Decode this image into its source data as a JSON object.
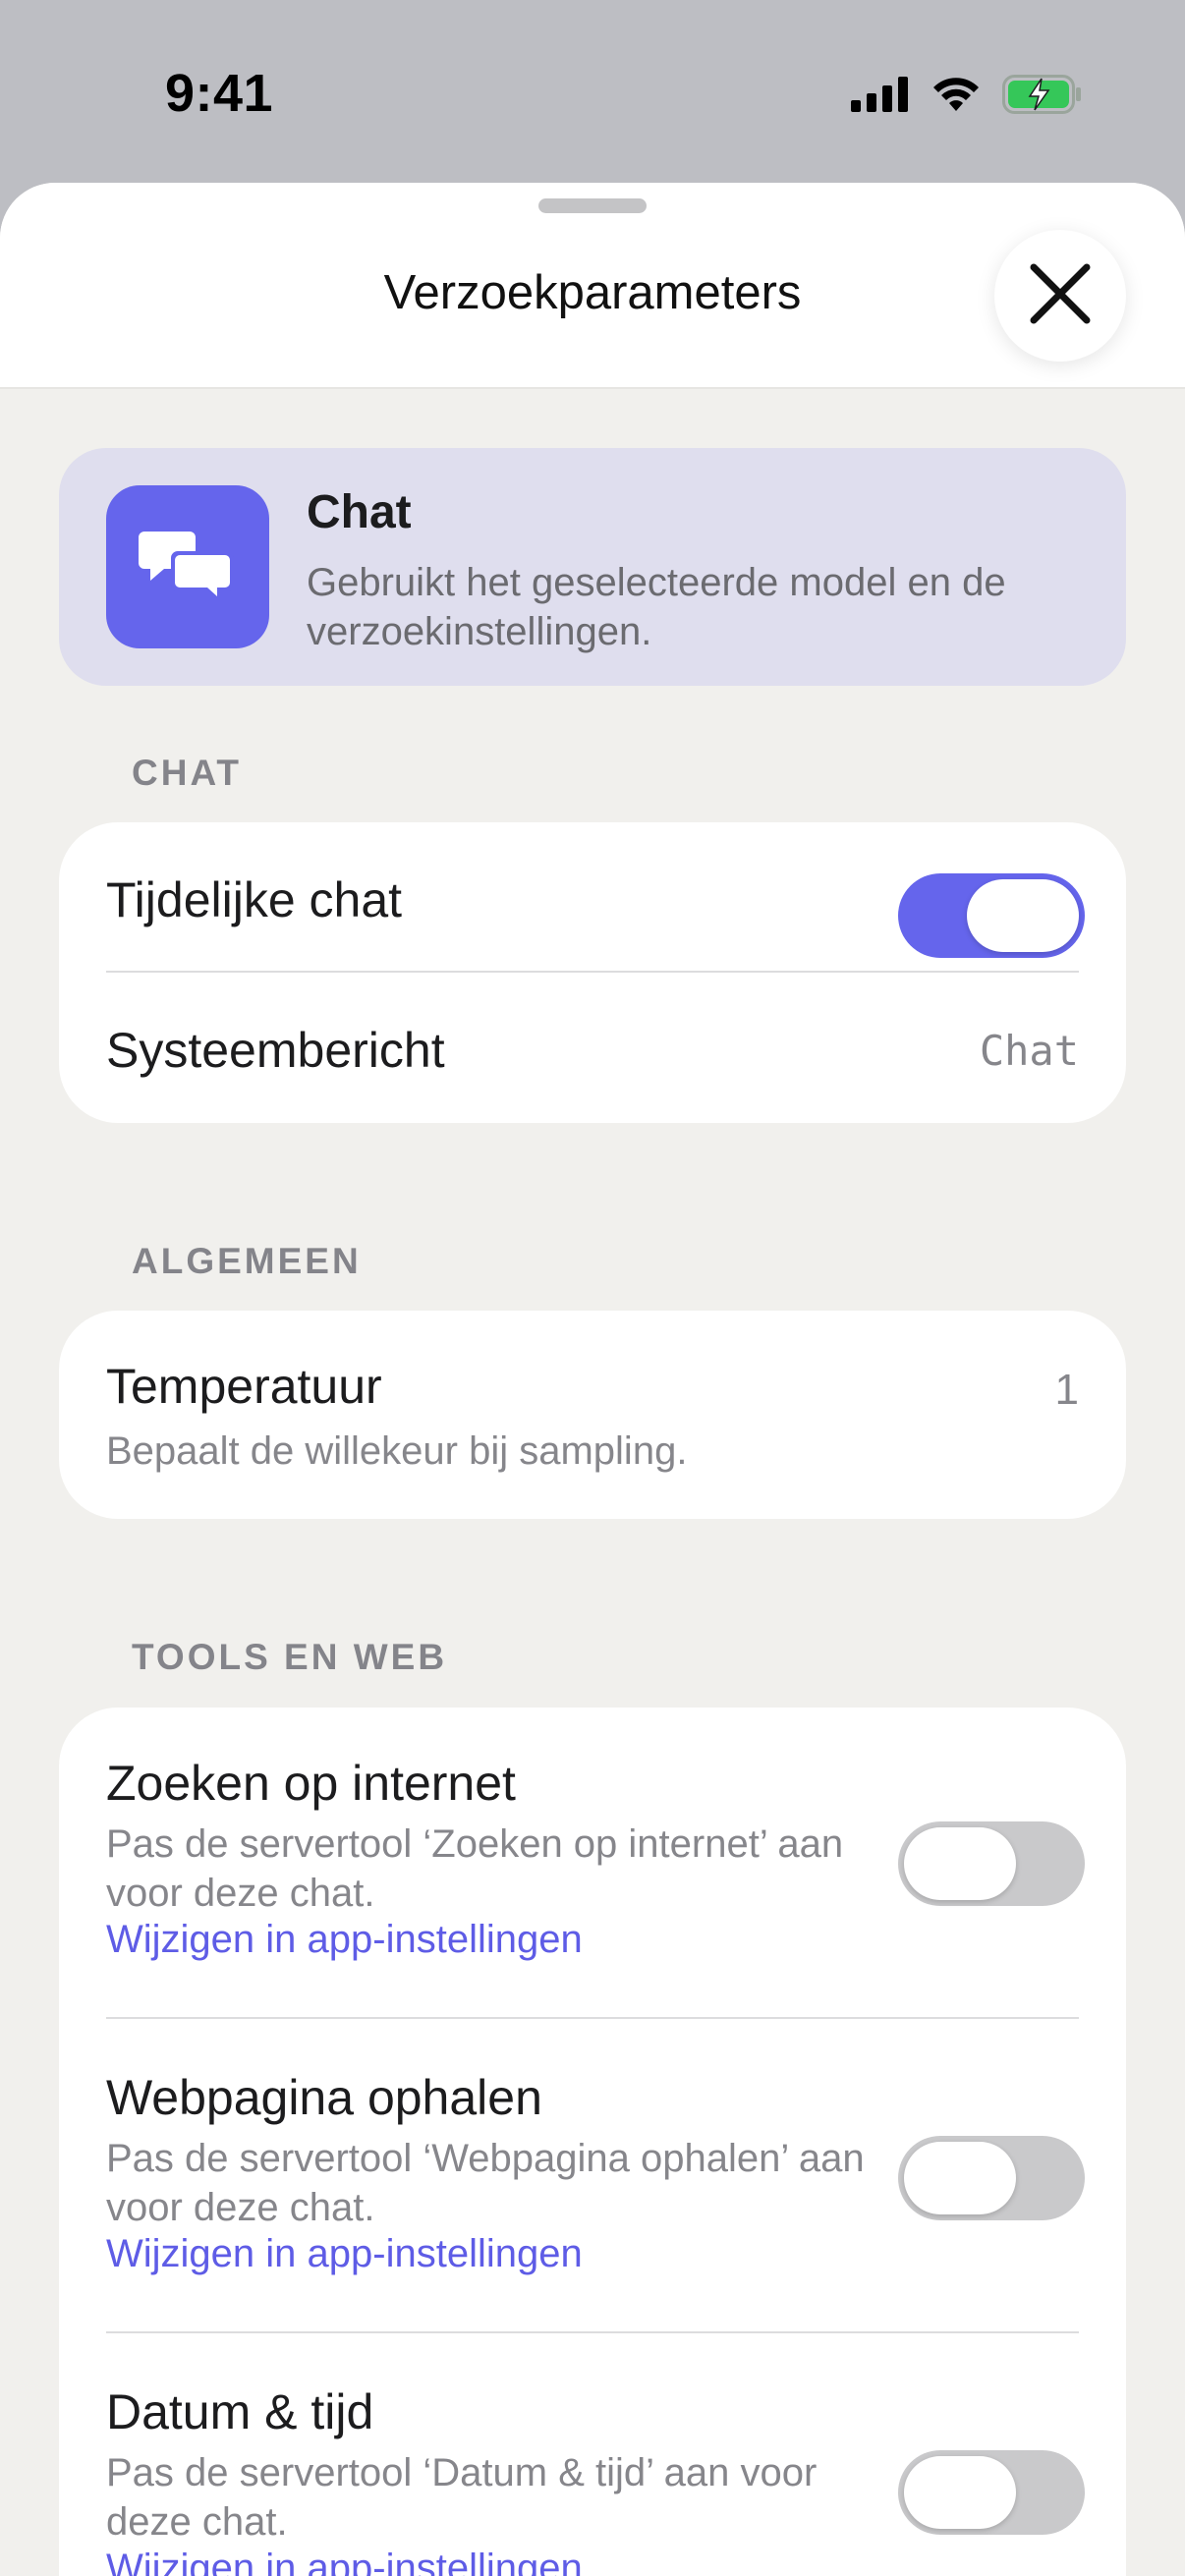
{
  "status_bar": {
    "time": "9:41",
    "icons": [
      "signal-icon",
      "wifi-icon",
      "battery-charging-icon"
    ]
  },
  "sheet": {
    "title": "Verzoekparameters",
    "close_icon": "close-icon"
  },
  "mode_banner": {
    "icon": "chat-bubbles-icon",
    "title": "Chat",
    "description": "Gebruikt het geselecteerde model en de verzoekinstellingen."
  },
  "sections": {
    "chat": {
      "header": "CHAT",
      "temporary_chat": {
        "label": "Tijdelijke chat",
        "enabled": true
      },
      "system_message": {
        "label": "Systeembericht",
        "value": "Chat"
      }
    },
    "general": {
      "header": "ALGEMEEN",
      "temperature": {
        "label": "Temperatuur",
        "value": "1",
        "description": "Bepaalt de willekeur bij sampling."
      }
    },
    "tools": {
      "header": "TOOLS EN WEB",
      "items": [
        {
          "label": "Zoeken op internet",
          "description": "Pas de servertool ‘Zoeken op internet’ aan voor deze chat.",
          "link": "Wijzigen in app-instellingen",
          "enabled": false
        },
        {
          "label": "Webpagina ophalen",
          "description": "Pas de servertool ‘Webpagina ophalen’ aan voor deze chat.",
          "link": "Wijzigen in app-instellingen",
          "enabled": false
        },
        {
          "label": "Datum & tijd",
          "description": "Pas de servertool ‘Datum & tijd’ aan voor deze chat.",
          "link": "Wijzigen in app-instellingen",
          "enabled": false
        }
      ]
    }
  },
  "colors": {
    "accent": "#6565ec",
    "link": "#5e5ce6",
    "toggle_off": "#c9c9cb",
    "banner_bg": "#dfdeee",
    "sheet_bg": "#f1f0ed"
  }
}
